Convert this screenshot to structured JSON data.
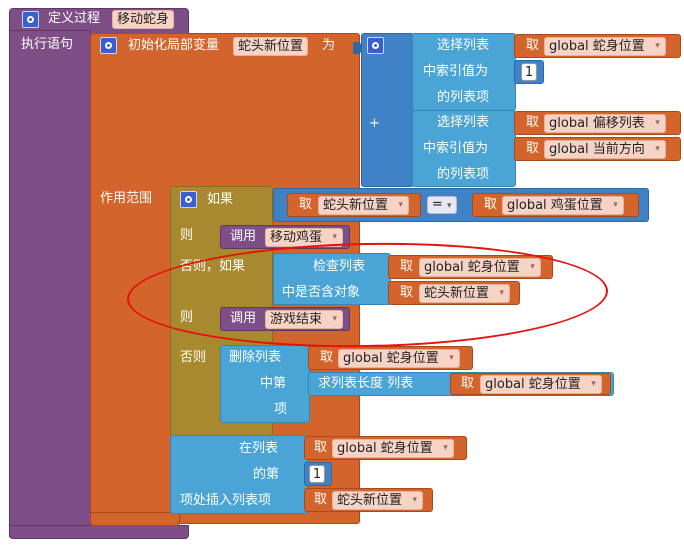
{
  "procedure": {
    "header": "定义过程",
    "name": "移动蛇身"
  },
  "exec_label": "执行语句",
  "init_local": {
    "label": "初始化局部变量",
    "var_name": "蛇头新位置",
    "as": "为"
  },
  "plus": {
    "symbol": "+"
  },
  "select1": {
    "l1": "选择列表",
    "l2": "中索引值为",
    "l3": "的列表项",
    "get": "取",
    "list": "global 蛇身位置",
    "index": "1"
  },
  "select2": {
    "l1": "选择列表",
    "l2": "中索引值为",
    "l3": "的列表项",
    "get": "取",
    "list": "global 偏移列表",
    "index_var": "global 当前方向"
  },
  "scope_label": "作用范围",
  "if_block": {
    "if_label": "如果",
    "get": "取",
    "left_var": "蛇头新位置",
    "op": "=",
    "right_var": "global 鸡蛋位置",
    "then1": "则",
    "call1_label": "调用",
    "call1_name": "移动鸡蛋",
    "elseif": "否则，如果",
    "check_l1": "检查列表",
    "check_l2": "中是否含对象",
    "check_list": "global 蛇身位置",
    "check_obj": "蛇头新位置",
    "then2": "则",
    "call2_label": "调用",
    "call2_name": "游戏结束",
    "else_label": "否则"
  },
  "remove": {
    "l1": "删除列表",
    "l2": "中第",
    "l3": "项",
    "list": "global 蛇身位置",
    "len_label": "求列表长度  列表",
    "len_list": "global 蛇身位置"
  },
  "insert": {
    "l1": "在列表",
    "l2": "的第",
    "l3": "项处插入列表项",
    "list": "global 蛇身位置",
    "index": "1",
    "item": "蛇头新位置"
  }
}
